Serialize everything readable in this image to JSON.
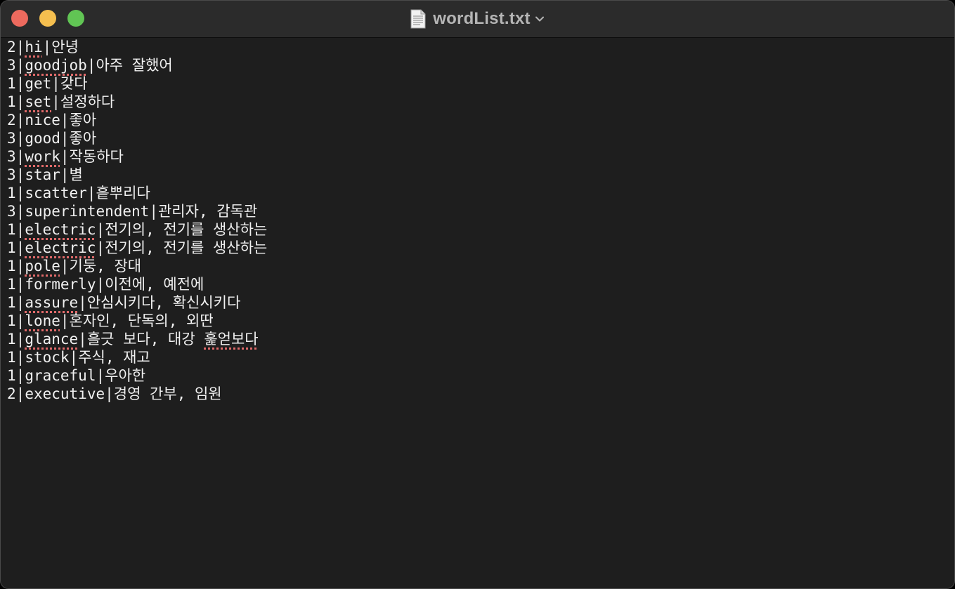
{
  "window": {
    "title": "wordList.txt",
    "icons": {
      "document": "document-icon",
      "chevron": "chevron-down-icon"
    },
    "colors": {
      "close": "#ed6a5e",
      "minimize": "#f5bf4f",
      "maximize": "#61c554"
    }
  },
  "lines": [
    {
      "num": "2",
      "word": "hi",
      "meaning": "안녕",
      "misspelled": true,
      "meaning_misspelled": false
    },
    {
      "num": "3",
      "word": "goodjob",
      "meaning": "아주 잘했어",
      "misspelled": true,
      "meaning_misspelled": false
    },
    {
      "num": "1",
      "word": "get",
      "meaning": "갖다",
      "misspelled": false,
      "meaning_misspelled": false
    },
    {
      "num": "1",
      "word": "set",
      "meaning": "설정하다",
      "misspelled": true,
      "meaning_misspelled": false
    },
    {
      "num": "2",
      "word": "nice",
      "meaning": "좋아",
      "misspelled": false,
      "meaning_misspelled": false
    },
    {
      "num": "3",
      "word": "good",
      "meaning": "좋아",
      "misspelled": false,
      "meaning_misspelled": false
    },
    {
      "num": "3",
      "word": "work",
      "meaning": "작동하다",
      "misspelled": true,
      "meaning_misspelled": false
    },
    {
      "num": "3",
      "word": "star",
      "meaning": "별",
      "misspelled": false,
      "meaning_misspelled": false
    },
    {
      "num": "1",
      "word": "scatter",
      "meaning": "흩뿌리다",
      "misspelled": false,
      "meaning_misspelled": false
    },
    {
      "num": "3",
      "word": "superintendent",
      "meaning": "관리자, 감독관",
      "misspelled": false,
      "meaning_misspelled": false
    },
    {
      "num": "1",
      "word": "electric",
      "meaning": "전기의, 전기를 생산하는",
      "misspelled": true,
      "meaning_misspelled": false
    },
    {
      "num": "1",
      "word": "electric",
      "meaning": "전기의, 전기를 생산하는",
      "misspelled": true,
      "meaning_misspelled": false
    },
    {
      "num": "1",
      "word": "pole",
      "meaning": "기둥, 장대",
      "misspelled": true,
      "meaning_misspelled": false
    },
    {
      "num": "1",
      "word": "formerly",
      "meaning": "이전에, 예전에",
      "misspelled": false,
      "meaning_misspelled": false
    },
    {
      "num": "1",
      "word": "assure",
      "meaning": "안심시키다, 확신시키다",
      "misspelled": true,
      "meaning_misspelled": false
    },
    {
      "num": "1",
      "word": "lone",
      "meaning": "혼자인, 단독의, 외딴",
      "misspelled": true,
      "meaning_misspelled": false
    },
    {
      "num": "1",
      "word": "glance",
      "meaning": "흘긋 보다, 대강 ",
      "meaning_extra": "훑얻보다",
      "misspelled": true,
      "meaning_misspelled": true
    },
    {
      "num": "1",
      "word": "stock",
      "meaning": "주식, 재고",
      "misspelled": false,
      "meaning_misspelled": false
    },
    {
      "num": "1",
      "word": "graceful",
      "meaning": "우아한",
      "misspelled": false,
      "meaning_misspelled": false
    },
    {
      "num": "2",
      "word": "executive",
      "meaning": "경영 간부, 임원",
      "misspelled": false,
      "meaning_misspelled": false
    }
  ]
}
